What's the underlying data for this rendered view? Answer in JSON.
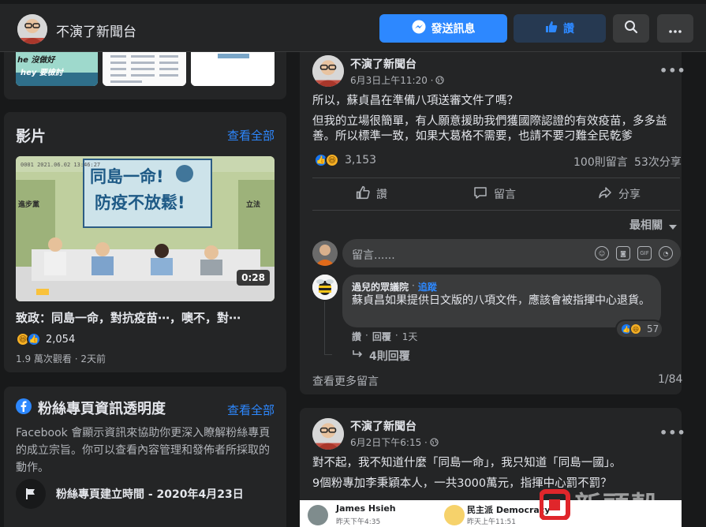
{
  "header": {
    "page_name": "不演了新聞台",
    "send_message_label": "發送訊息",
    "like_label": "讚"
  },
  "left": {
    "photo_thumb_texts": [
      "he 沒做好",
      "hey 要檢討"
    ],
    "videos": {
      "title": "影片",
      "see_all": "查看全部",
      "banner_text": [
        "同島一命!",
        "防疫不放鬆!"
      ],
      "duration": "0:28",
      "video_title": "致政：同島一命，對抗疫苗⋯，噢不，對⋯",
      "reaction_count": "2,054",
      "stats": "1.9 萬次觀看 · 2天前"
    },
    "transparency": {
      "title": "粉絲專頁資訊透明度",
      "see_all": "查看全部",
      "description": "Facebook 會顯示資訊來協助你更深入瞭解粉絲專頁的成立宗旨。你可以查看內容管理和發佈者所採取的動作。",
      "created_label": "粉絲專頁建立時間 - 2020年4月23日"
    }
  },
  "post1": {
    "author": "不演了新聞台",
    "time": "6月3日上午11:20 ·",
    "line1": "所以，蘇貞昌在準備八項送審文件了嗎？",
    "line2": "但我的立場很簡單，有人願意援助我們獲國際認證的有效疫苗，多多益善。所以標準一致，如果大葛格不需要，也請不要刁難全民乾爹",
    "reactions": "3,153",
    "comments": "100則留言",
    "shares": "53次分享",
    "actions": {
      "like": "讚",
      "comment": "留言",
      "share": "分享"
    },
    "sort": "最相關",
    "comment_placeholder": "留言......",
    "top_comment": {
      "author": "過兒的眾議院",
      "follow": "追蹤",
      "text": "蘇貞昌如果提供日文版的八項文件，應該會被指揮中心退貨。",
      "like": "讚",
      "reply": "回覆",
      "time": "1天",
      "reaction_count": "57",
      "replies": "4則回覆"
    },
    "view_more": "查看更多留言",
    "pager": "1/84"
  },
  "post2": {
    "author": "不演了新聞台",
    "time": "6月2日下午6:15 ·",
    "line1": "對不起，我不知道什麼「同島一命」，我只知道「同島一國」。",
    "line2": "9個粉專加李秉穎本人，一共3000萬元，指揮中心罰不罰？",
    "preview_name_1": "James Hsieh",
    "preview_time_1": "昨天下午4:35",
    "preview_name_2": "民主派 Democracy",
    "preview_time_2": "昨天上午11:51"
  },
  "watermark": "新頭殼"
}
